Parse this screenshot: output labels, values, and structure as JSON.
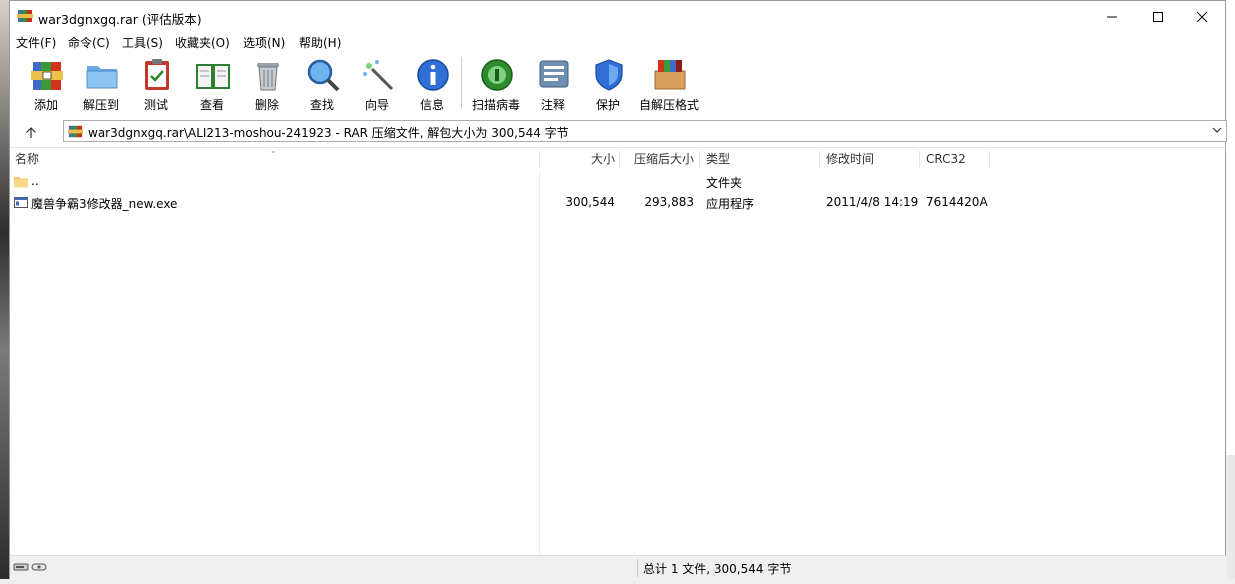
{
  "window": {
    "title": "war3dgnxgq.rar (评估版本)"
  },
  "menu": [
    "文件(F)",
    "命令(C)",
    "工具(S)",
    "收藏夹(O)",
    "选项(N)",
    "帮助(H)"
  ],
  "toolbar": [
    {
      "label": "添加",
      "icon": "add-archive-icon"
    },
    {
      "label": "解压到",
      "icon": "extract-folder-icon"
    },
    {
      "label": "测试",
      "icon": "test-clipboard-icon"
    },
    {
      "label": "查看",
      "icon": "view-book-icon"
    },
    {
      "label": "删除",
      "icon": "trash-can-icon"
    },
    {
      "label": "查找",
      "icon": "magnifier-icon"
    },
    {
      "label": "向导",
      "icon": "magic-wand-icon"
    },
    {
      "label": "信息",
      "icon": "info-icon"
    },
    {
      "label": "扫描病毒",
      "icon": "virus-scan-icon"
    },
    {
      "label": "注释",
      "icon": "comment-icon"
    },
    {
      "label": "保护",
      "icon": "shield-icon"
    },
    {
      "label": "自解压格式",
      "icon": "sfx-box-icon"
    }
  ],
  "address": {
    "path": "war3dgnxgq.rar\\ALI213-moshou-241923 - RAR 压缩文件, 解包大小为 300,544 字节"
  },
  "columns": [
    "名称",
    "大小",
    "压缩后大小",
    "类型",
    "修改时间",
    "CRC32"
  ],
  "rows": [
    {
      "name": "..",
      "size": "",
      "packed": "",
      "type": "文件夹",
      "modified": "",
      "crc": "",
      "icon": "folder-icon"
    },
    {
      "name": "魔兽争霸3修改器_new.exe",
      "size": "300,544",
      "packed": "293,883",
      "type": "应用程序",
      "modified": "2011/4/8 14:19",
      "crc": "7614420A",
      "icon": "exe-file-icon"
    }
  ],
  "status": {
    "text": "总计 1 文件, 300,544 字节"
  },
  "colors": {
    "window_bg": "#ffffff",
    "status_bg": "#f0f0f0",
    "accent": "#0078d7"
  }
}
